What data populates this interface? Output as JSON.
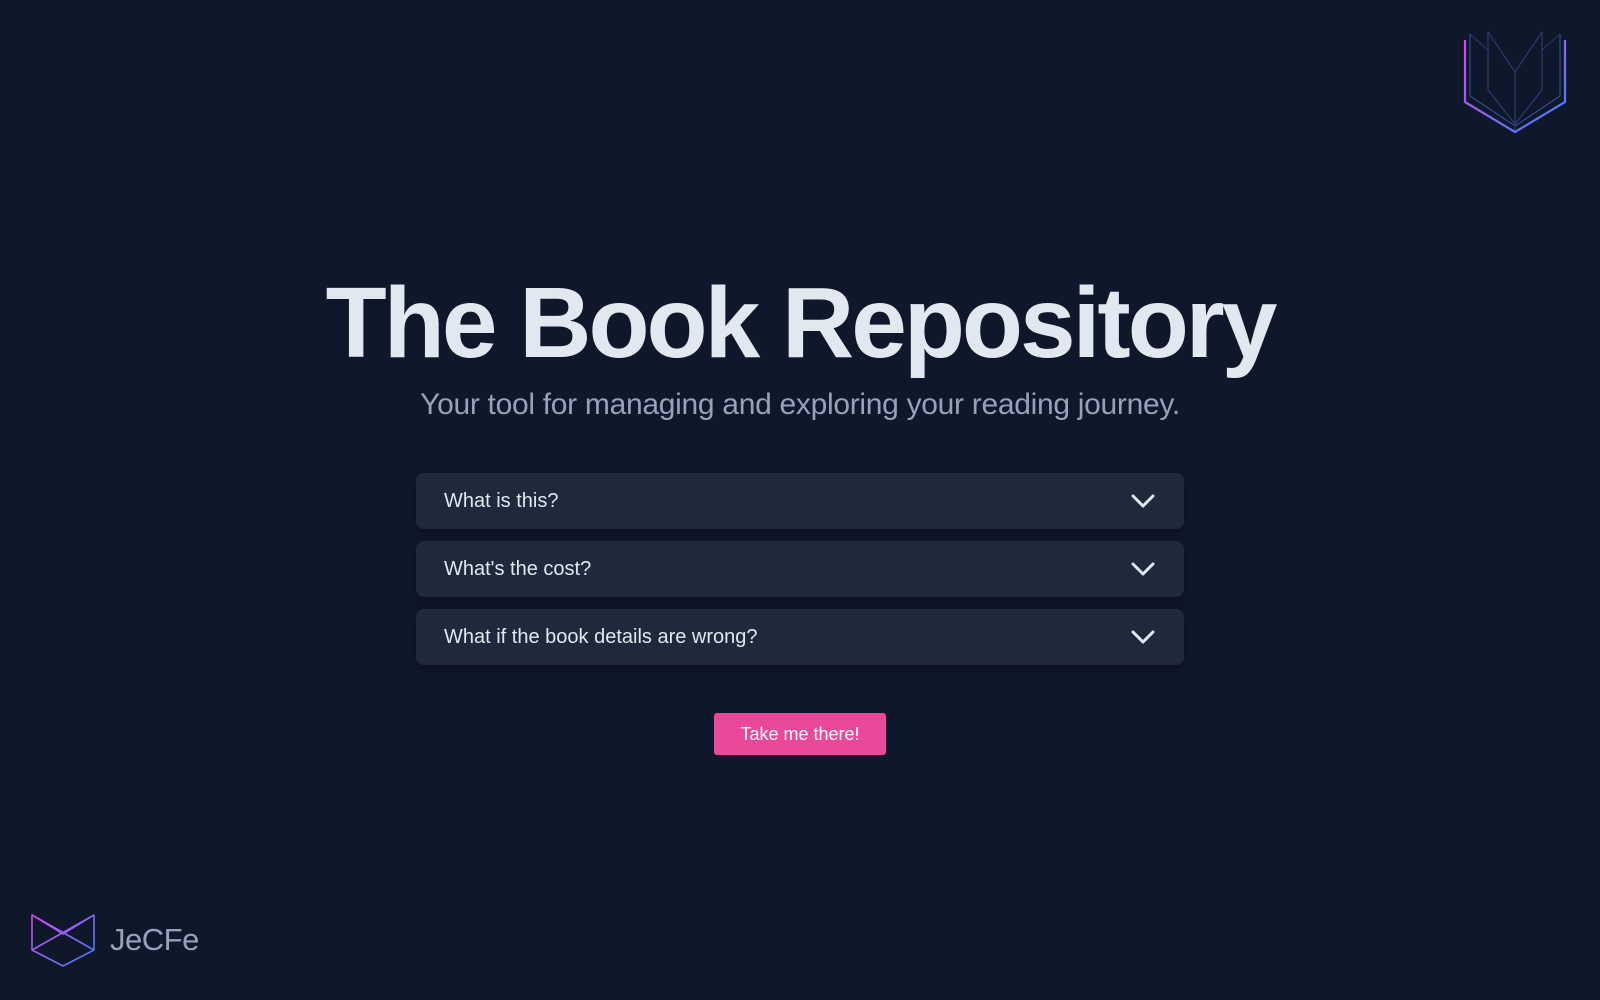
{
  "header": {
    "logo_icon": "open-book-icon"
  },
  "hero": {
    "title": "The Book Repository",
    "subtitle": "Your tool for managing and exploring your reading journey."
  },
  "faq": {
    "items": [
      {
        "question": "What is this?",
        "icon": "chevron-down-icon",
        "expanded": false
      },
      {
        "question": "What's the cost?",
        "icon": "chevron-down-icon",
        "expanded": false
      },
      {
        "question": "What if the book details are wrong?",
        "icon": "chevron-down-icon",
        "expanded": false
      }
    ]
  },
  "cta": {
    "label": "Take me there!"
  },
  "footer": {
    "brand_name": "JeCFe",
    "brand_icon": "jecfe-logo-icon"
  },
  "colors": {
    "background": "#0f172a",
    "card": "#1e293b",
    "title": "#e2e8f0",
    "subtitle": "#94a3b8",
    "accent": "#ec4899",
    "logo_gradient_start": "#d946ef",
    "logo_gradient_end": "#3b82f6"
  }
}
